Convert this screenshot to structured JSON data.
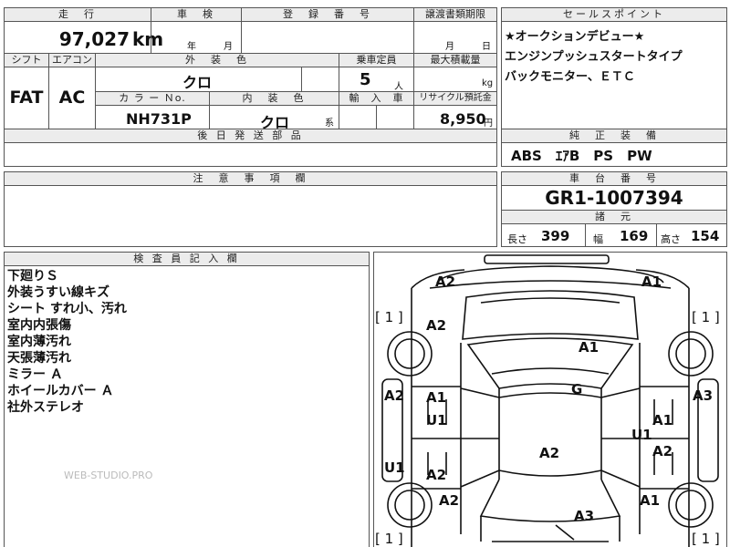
{
  "left_table": {
    "h_mileage": "走　行",
    "h_inspection": "車　検",
    "h_registration": "登　録　番　号",
    "h_transfer": "譲渡書類期限",
    "mileage_value": "97,027",
    "mileage_unit": "km",
    "inspection_year_unit": "年",
    "inspection_month_unit": "月",
    "transfer_month_unit": "月",
    "transfer_day_unit": "日",
    "h_shift": "シフト",
    "h_aircon": "エアコン",
    "h_exterior_color": "外　装　色",
    "h_capacity": "乗車定員",
    "h_max_load": "最大積載量",
    "shift_value": "FAT",
    "aircon_value": "AC",
    "exterior_color_value": "クロ",
    "capacity_value": "5",
    "capacity_unit": "人",
    "max_load_unit": "kg",
    "h_color_no": "カ ラ ー Ｎo.",
    "h_interior_color": "内　装　色",
    "h_import": "輸　入　車",
    "h_recycle": "リサイクル預託金",
    "color_no_value": "NH731P",
    "interior_color_value": "クロ",
    "interior_color_suffix": "系",
    "recycle_value": "8,950",
    "recycle_unit": "円",
    "h_later_parts": "後 日 発 送 部 品"
  },
  "sales_point": {
    "header": "セールスポイント",
    "lines": [
      "★オークションデビュー★",
      "エンジンプッシュスタートタイプ",
      "バックモニター、ＥＴＣ"
    ]
  },
  "equipment": {
    "header": "純　正　装　備",
    "value": "ABS　ｴｱB　PS　PW"
  },
  "notes": {
    "header": "注　意　事　項　欄"
  },
  "chassis": {
    "header": "車　台　番　号",
    "value": "GR1-1007394",
    "dims_header": "諸　元",
    "length_label": "長さ",
    "length_value": "399",
    "width_label": "幅",
    "width_value": "169",
    "height_label": "高さ",
    "height_value": "154"
  },
  "inspector": {
    "header": "検 査 員 記 入 欄",
    "lines": [
      "下廻りＳ",
      "外装うすい線キズ",
      "シート すれ小、汚れ",
      "室内内張傷",
      "室内薄汚れ",
      "天張薄汚れ",
      "ミラー Ａ",
      "ホイールカバー Ａ",
      "社外ステレオ"
    ],
    "watermark": "WEB-STUDIO.PRO"
  },
  "diagram_marks": {
    "bracket_tl": "[ 1 ]",
    "bracket_tr": "[ 1 ]",
    "bracket_bl": "[ 1 ]",
    "bracket_br": "[ 1 ]",
    "front_left_corner": "A2",
    "front_right_corner": "A1",
    "left_front_fender": "A2",
    "hood": "A1",
    "left_side_edge": "A2",
    "right_side_edge": "A3",
    "left_front_door": "A1",
    "left_front_door_lower": "U1",
    "windshield": "G",
    "right_front_door": "A1",
    "right_front_door_lower": "U1",
    "left_sill": "U1",
    "left_rear_door": "A2",
    "roof": "A2",
    "right_rear_door": "A2",
    "left_rear_fender": "A2",
    "right_rear_fender": "A1",
    "trunk": "A3"
  }
}
